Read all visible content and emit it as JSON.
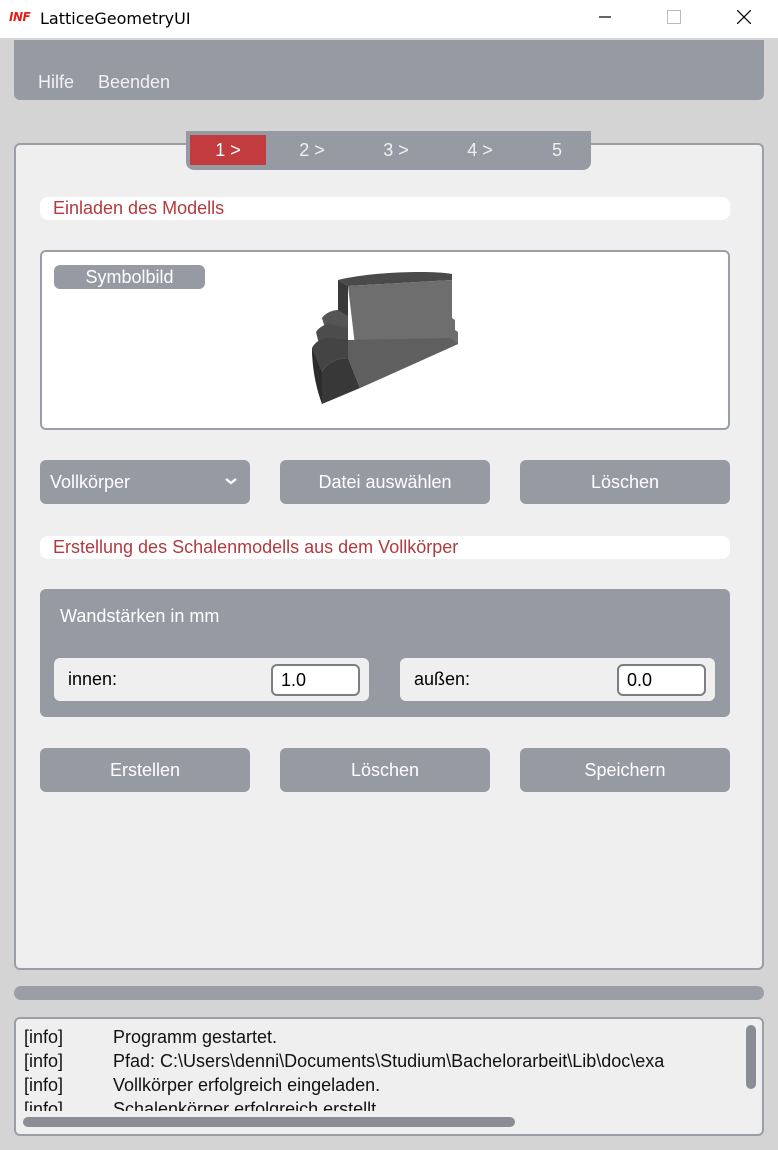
{
  "window": {
    "logo_text": "INF",
    "title": "LatticeGeometryUI"
  },
  "menu": {
    "items": [
      "Hilfe",
      "Beenden"
    ]
  },
  "steps": [
    "1 >",
    "2 >",
    "3 >",
    "4 >",
    "5"
  ],
  "active_step": 1,
  "load_section": {
    "header": "Einladen des Modells",
    "symbol_label": "Symbolbild",
    "dropdown_value": "Vollkörper",
    "select_file_button": "Datei auswählen",
    "delete_button": "Löschen"
  },
  "shell_section": {
    "header": "Erstellung des Schalenmodells aus dem Vollkörper",
    "wall_title": "Wandstärken in mm",
    "inner_label": "innen:",
    "inner_value": "1.0",
    "outer_label": "außen:",
    "outer_value": "0.0",
    "create_button": "Erstellen",
    "delete_button": "Löschen",
    "save_button": "Speichern"
  },
  "log": {
    "lines": [
      {
        "tag": "[info]",
        "msg": "Programm gestartet."
      },
      {
        "tag": "[info]",
        "msg": "Pfad: C:\\Users\\denni\\Documents\\Studium\\Bachelorarbeit\\Lib\\doc\\exa"
      },
      {
        "tag": "[info]",
        "msg": "Vollkörper erfolgreich eingeladen."
      },
      {
        "tag": "[info]",
        "msg": "Schalenkörper erfolgreich erstellt."
      }
    ]
  },
  "colors": {
    "accent_red": "#c13b3f",
    "header_text_red": "#b23a3e",
    "panel_gray": "#969aa3"
  }
}
